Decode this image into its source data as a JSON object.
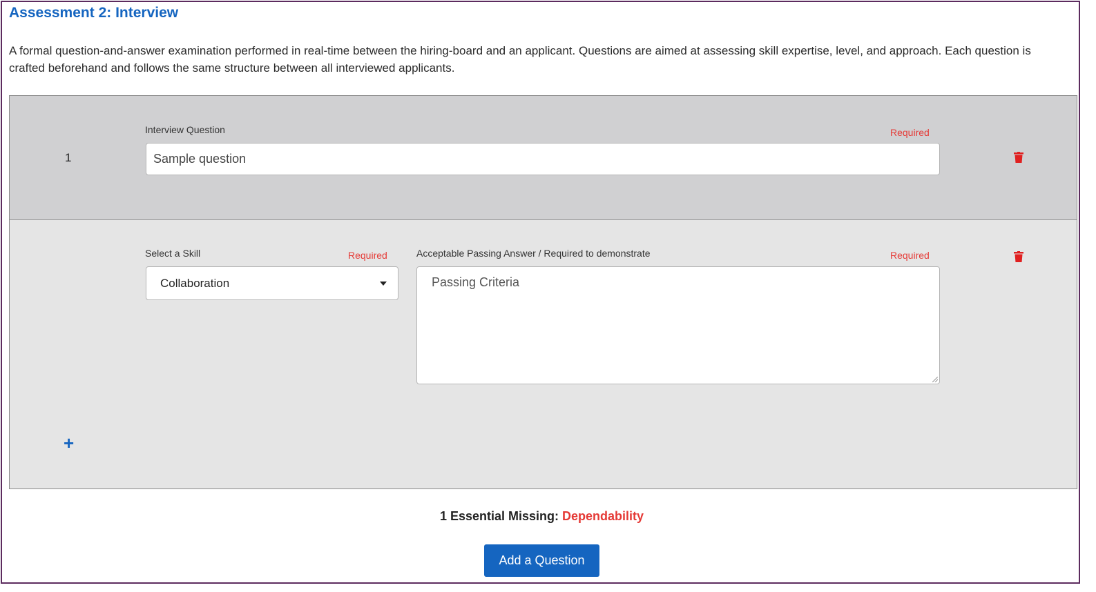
{
  "header": {
    "title": "Assessment 2: Interview",
    "description": "A formal question-and-answer examination performed in real-time between the hiring-board and an applicant. Questions are aimed at assessing skill expertise, level, and approach. Each question is crafted beforehand and follows the same structure between all interviewed applicants."
  },
  "question": {
    "number": "1",
    "question_label": "Interview Question",
    "question_required": "Required",
    "question_value": "Sample question",
    "skill_label": "Select a Skill",
    "skill_required": "Required",
    "skill_selected": "Collaboration",
    "answer_label": "Acceptable Passing Answer / Required to demonstrate",
    "answer_required": "Required",
    "answer_placeholder": "Passing Criteria",
    "add_skill_icon": "plus-icon",
    "delete_icon": "trash-icon"
  },
  "status": {
    "prefix": "1 Essential Missing:",
    "missing_skill": "Dependability"
  },
  "actions": {
    "add_question_label": "Add a Question"
  },
  "colors": {
    "accent": "#1565c0",
    "required": "#e53935",
    "frame": "#5c2b5e"
  }
}
